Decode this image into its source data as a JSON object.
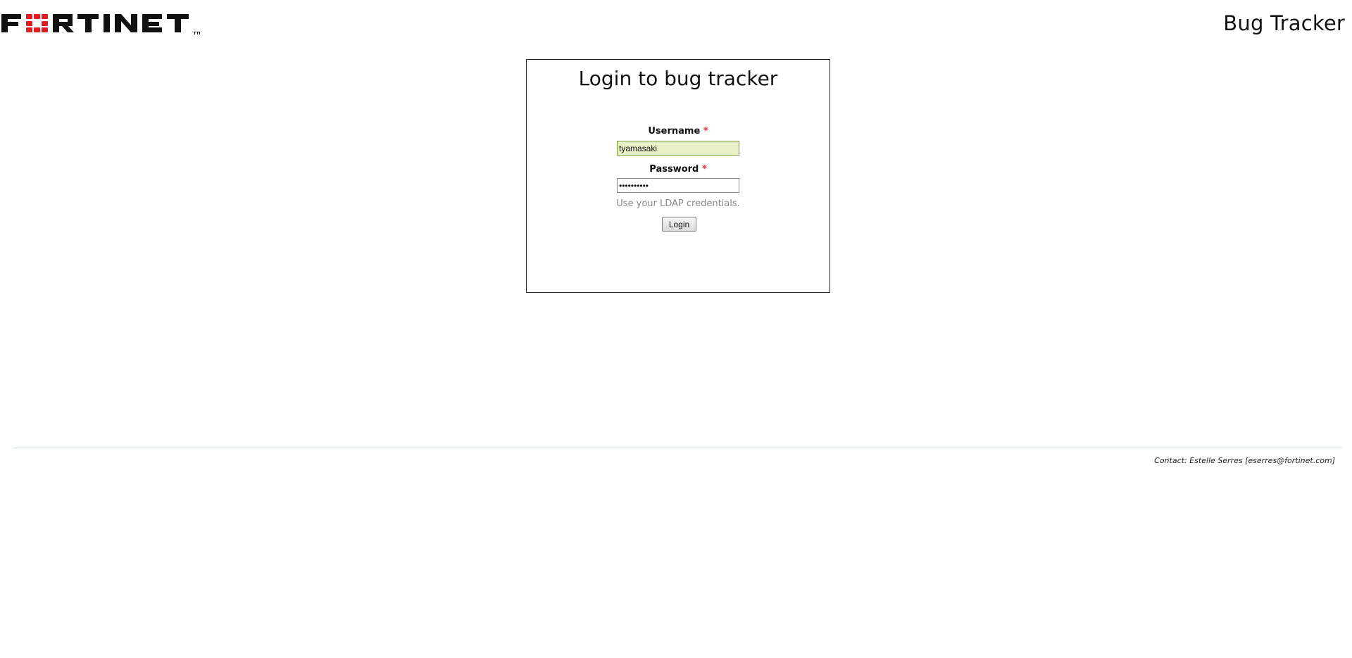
{
  "header": {
    "logo_text": "FORTINET",
    "app_title": "Bug Tracker"
  },
  "login": {
    "title": "Login to bug tracker",
    "username_label": "Username",
    "password_label": "Password",
    "required_marker": "*",
    "username_value": "tyamasaki",
    "password_value": "••••••••••",
    "hint": "Use your LDAP credentials.",
    "button_label": "Login"
  },
  "footer": {
    "contact": "Contact: Estelle Serres [eserres@fortinet.com]"
  },
  "colors": {
    "logo_red": "#e31b23",
    "required_red": "#e03030",
    "username_bg": "#e8f0c8",
    "hint_gray": "#8a8a8a",
    "divider": "#cfe3e3"
  }
}
